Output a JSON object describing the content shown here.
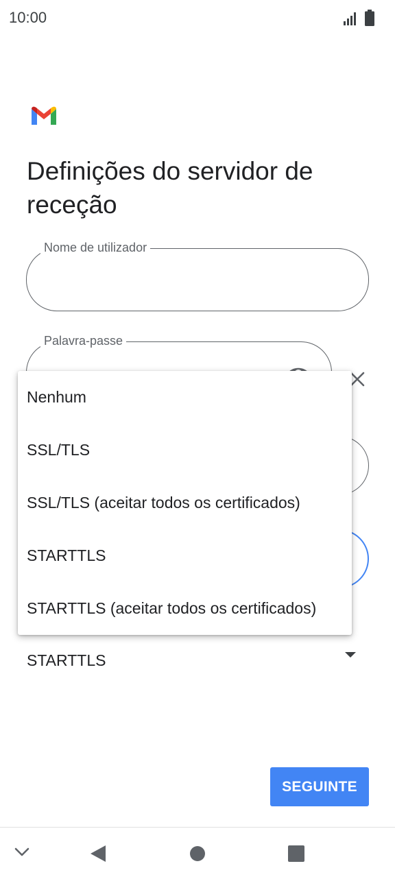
{
  "status_bar": {
    "time": "10:00",
    "icons": [
      "signal-icon",
      "battery-icon"
    ]
  },
  "app": {
    "logo": "gmail-logo-icon",
    "title": "Definições do servidor de receção"
  },
  "form": {
    "username_label": "Nome de utilizador",
    "username_value": "",
    "password_label": "Palavra-passe",
    "password_value": "",
    "security_value": "STARTTLS"
  },
  "menu": {
    "options": [
      "Nenhum",
      "SSL/TLS",
      "SSL/TLS (aceitar todos os certificados)",
      "STARTTLS",
      "STARTTLS (aceitar todos os certificados)"
    ]
  },
  "actions": {
    "next_label": "SEGUINTE"
  },
  "nav_bar": {
    "icons": [
      "chevron-down-icon",
      "back-icon",
      "home-icon",
      "recents-icon"
    ]
  },
  "colors": {
    "accent": "#4285f4",
    "text": "#202124",
    "secondary_text": "#5f6368"
  }
}
